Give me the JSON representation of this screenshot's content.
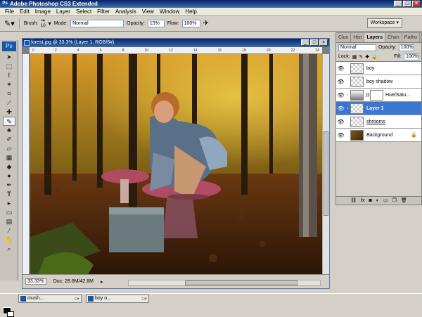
{
  "app": {
    "title": "Adobe Photoshop CS3 Extended",
    "logo": "Ps"
  },
  "menu": [
    "File",
    "Edit",
    "Image",
    "Layer",
    "Select",
    "Filter",
    "Analysis",
    "View",
    "Window",
    "Help"
  ],
  "options": {
    "brush_label": "Brush:",
    "brush_size": "10",
    "mode_label": "Mode:",
    "mode_value": "Normal",
    "opacity_label": "Opacity:",
    "opacity_value": "15%",
    "flow_label": "Flow:",
    "flow_value": "100%",
    "workspace_label": "Workspace ▾"
  },
  "document": {
    "title": "forest.jpg @ 33.3% (Layer 1, RGB/8#)",
    "zoom": "33.33%",
    "doc_size": "Doc: 28.6M/42.8M",
    "ruler_marks": [
      "0",
      "2",
      "4",
      "6",
      "8",
      "10",
      "12",
      "14",
      "16",
      "18",
      "20",
      "22",
      "24"
    ]
  },
  "layers_panel": {
    "tabs": [
      "Clon",
      "Hist",
      "Layers",
      "Chan",
      "Patho"
    ],
    "blend_mode": "Normal",
    "opacity_label": "Opacity:",
    "opacity_value": "100%",
    "lock_label": "Lock:",
    "fill_label": "Fill:",
    "fill_value": "100%",
    "layers": [
      {
        "name": "boy",
        "type": "transparent",
        "selected": false
      },
      {
        "name": "boy shadow",
        "type": "transparent",
        "selected": false
      },
      {
        "name": "Hue/Satu...",
        "type": "adjustment",
        "selected": false
      },
      {
        "name": "Layer 1",
        "type": "transparent",
        "selected": true
      },
      {
        "name": "shrooms",
        "type": "transparent",
        "selected": false
      },
      {
        "name": "Background",
        "type": "background",
        "selected": false
      }
    ],
    "bottom_icons": [
      "link-icon",
      "fx-icon",
      "mask-icon",
      "adjustment-icon",
      "folder-icon",
      "new-layer-icon",
      "trash-icon"
    ]
  },
  "taskbar": [
    {
      "label": "mush..."
    },
    {
      "label": "boy o..."
    }
  ]
}
